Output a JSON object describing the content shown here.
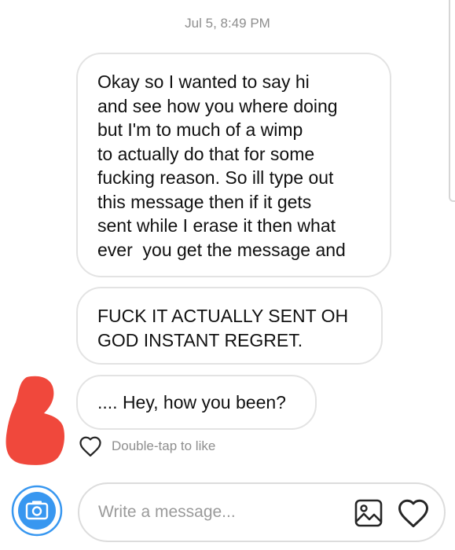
{
  "thread": {
    "timestamp": "Jul 5, 8:49 PM",
    "messages": [
      {
        "lines": [
          "Okay so I wanted to say hi",
          "and see how you where doing",
          "but I'm to much of a wimp",
          "to actually do that for some",
          "fucking reason. So ill type out",
          "this message then if it gets",
          "sent while I erase it then what",
          "ever  you get the message and"
        ]
      },
      {
        "lines": [
          "FUCK IT ACTUALLY SENT OH",
          "GOD INSTANT REGRET."
        ]
      },
      {
        "lines": [
          ".... Hey, how you been?"
        ]
      }
    ],
    "like_hint": "Double-tap to like",
    "redaction_color": "#f0483c"
  },
  "composer": {
    "placeholder": "Write a message...",
    "camera_icon": "camera-icon",
    "gallery_icon": "image-icon",
    "like_icon": "heart-icon",
    "accent_color": "#3897f0"
  }
}
